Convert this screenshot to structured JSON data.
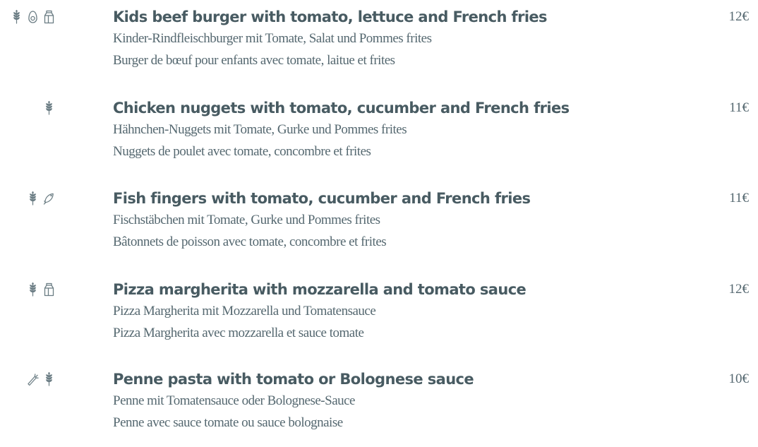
{
  "colors": {
    "text": "#485b62",
    "icon": "#6b7d84",
    "background": "#ffffff"
  },
  "items": [
    {
      "icons": [
        "wheat-icon",
        "egg-icon",
        "milk-carton-icon"
      ],
      "title": "Kids beef burger with tomato, lettuce and French fries",
      "de": "Kinder-Rindfleischburger mit Tomate, Salat und Pommes frites",
      "fr": "Burger de bœuf pour enfants avec tomate, laitue et frites",
      "price": "12€"
    },
    {
      "icons": [
        "wheat-icon"
      ],
      "title": "Chicken nuggets with tomato, cucumber and French fries",
      "de": "Hähnchen-Nuggets mit Tomate, Gurke und Pommes frites",
      "fr": "Nuggets de poulet avec tomate, concombre et frites",
      "price": "11€"
    },
    {
      "icons": [
        "wheat-icon",
        "fish-icon"
      ],
      "title": "Fish fingers with tomato, cucumber and French fries",
      "de": "Fischstäbchen mit Tomate, Gurke und Pommes frites",
      "fr": "Bâtonnets de poisson avec tomate, concombre et frites",
      "price": "11€"
    },
    {
      "icons": [
        "wheat-icon",
        "milk-carton-icon"
      ],
      "title": "Pizza margherita with mozzarella and tomato sauce",
      "de": "Pizza Margherita mit Mozzarella und Tomatensauce",
      "fr": "Pizza Margherita avec mozzarella et sauce tomate",
      "price": "12€"
    },
    {
      "icons": [
        "celery-icon",
        "wheat-icon"
      ],
      "title": "Penne pasta with tomato or Bolognese sauce",
      "de": "Penne mit Tomatensauce oder Bolognese-Sauce",
      "fr": "Penne avec sauce tomate ou sauce bolognaise",
      "price": "10€"
    }
  ]
}
